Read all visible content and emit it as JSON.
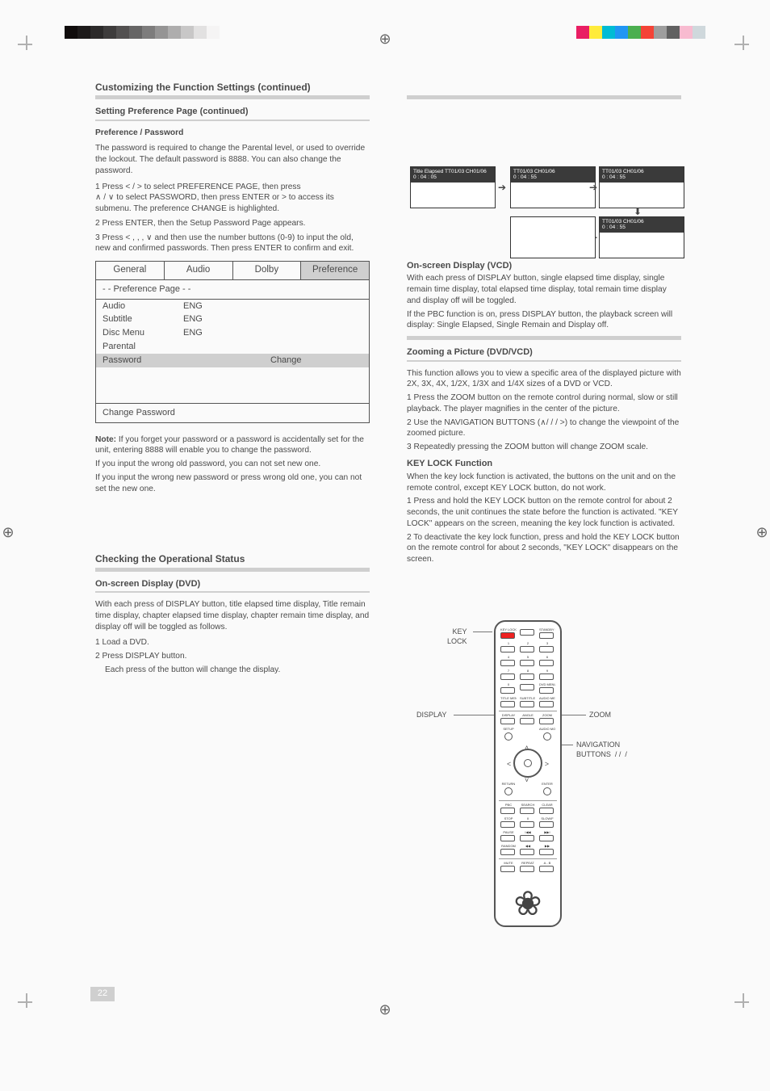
{
  "colorbar_left": [
    "#100c0c",
    "#1d1a1a",
    "#2c2a2a",
    "#3e3c3c",
    "#525050",
    "#666565",
    "#7d7c7c",
    "#959494",
    "#aeadad",
    "#c8c7c7",
    "#e2e1e1",
    "#f5f4f4"
  ],
  "colorbar_right": [
    "#e91e63",
    "#ffeb3b",
    "#00bcd4",
    "#2196f3",
    "#4caf50",
    "#f44336",
    "#9e9e9e",
    "#616161",
    "#f8bbd0",
    "#cfd8dc"
  ],
  "left": {
    "h_customizing": "Customizing the Function Settings (continued)",
    "h_setting": "Setting Preference Page (continued)",
    "h_pref_pass": "Preference / Password",
    "p_pass": "The password is required to change the Parental level, or used to override the lockout. The default password is 8888. You can also change the password.",
    "li1_pre": "1    Press ",
    "li1_a": " / ",
    "li1_post": " to select PREFERENCE PAGE, then press",
    "li1b_pre": "",
    "li1b_a": " / ",
    "li1b_post": " to select PASSWORD, then press ENTER or > to access its submenu. The preference CHANGE is highlighted.",
    "li2": "2    Press ENTER, then the Setup Password Page appears.",
    "li3_pre": "3    Press ",
    "li3_mid": " ,  ,  , ",
    "li3_post": " and then use the number buttons (0-9) to input the old, new and confirmed passwords. Then press ENTER to confirm and exit.",
    "menu": {
      "tabs": [
        "General",
        "Audio",
        "Dolby",
        "Preference"
      ],
      "page_title": "- -  Preference  Page  - -",
      "rows": [
        {
          "k": "Audio",
          "v": "ENG"
        },
        {
          "k": "Subtitle",
          "v": "ENG"
        },
        {
          "k": "Disc Menu",
          "v": "ENG"
        },
        {
          "k": "Parental",
          "v": ""
        }
      ],
      "highlight_k": "Password",
      "highlight_a": "Change",
      "footer": "Change Password"
    },
    "note_label": "Note:",
    "note_text": "If you forget your password or a password is accidentally set for the unit, entering 8888 will enable you to change the password.",
    "br1": "       If you input the wrong old password, you can not set new one.",
    "br2": "       If you input the wrong new password or press wrong old one, you can not set the new one.",
    "h_status": "Checking the Operational Status",
    "h_display": "On-screen Display (DVD)",
    "p_disp": "With each press of DISPLAY button, title elapsed time display, Title remain time display, chapter elapsed time display, chapter remain time display, and display off will be toggled as follows.",
    "li_d1": "1    Load a DVD.",
    "li_d2": "2    Press DISPLAY button.",
    "p_foot": "Each press of the button will change the display."
  },
  "osd": {
    "l1a": "Title Elapsed TT01/03 CH01/06",
    "l1b": "0 : 04 : 05",
    "l2a": "TT01/03 CH01/06",
    "l2b": "0 : 04 : 55",
    "l3a": "TT01/03 CH01/06",
    "l3b": "0 : 04 : 55",
    "l4a": "TT01/03 CH01/06",
    "l4b": "0 : 04 : 55"
  },
  "right": {
    "h_vcd": "On-screen Display (VCD)",
    "p_vcd1": "With each press of DISPLAY button, single elapsed time display, single remain time display, total elapsed time display, total remain time display and display off will be toggled.",
    "p_vcd2": "If the PBC function is on, press DISPLAY button, the playback screen will display: Single Elapsed, Single Remain and Display off.",
    "h_zoom": "Zooming a Picture (DVD/VCD)",
    "p_zoom1": "This function allows you to view a specific area of the displayed picture with 2X, 3X, 4X, 1/2X, 1/3X and 1/4X sizes of a DVD or VCD.",
    "li_z1": "1    Press the ZOOM button on the remote control during normal, slow or still playback. The player magnifies in the center of the picture.",
    "li_z2_pre": "2    Use the NAVIGATION BUTTONS (",
    "li_z2_mid": "/  /  / ",
    "li_z2_post": ") to change the viewpoint of the zoomed picture.",
    "li_z3": "3    Repeatedly pressing the ZOOM button will change ZOOM scale.",
    "h_keylock": "KEY LOCK Function",
    "p_kl": "When the key lock function is activated, the buttons on the unit and on the remote control, except KEY LOCK button, do not work.",
    "li_k1": "1    Press and hold the KEY LOCK button on the remote control for about 2 seconds, the unit continues the state before the function is activated. \"KEY LOCK\" appears on the screen, meaning the key lock function is activated.",
    "li_k2": "2    To deactivate the key lock function, press and hold the KEY LOCK button on the remote control for about 2 seconds, \"KEY LOCK\" disappears on the screen."
  },
  "callouts": {
    "key_lock": "KEY\nLOCK",
    "display": "DISPLAY",
    "zoom": "ZOOM",
    "nav": "NAVIGATION\nBUTTONS  / /  /"
  },
  "remote_labels": {
    "r1": [
      "KEY LOCK",
      "",
      "STANDBY ON/OFF"
    ],
    "r2": [
      "1",
      "2",
      "3"
    ],
    "r3": [
      "4",
      "5",
      "6"
    ],
    "r4": [
      "7",
      "8",
      "9"
    ],
    "r5": [
      "0",
      "",
      "DVD MENU"
    ],
    "r6": [
      "TITLE MENU",
      "SUBTITLE MENU",
      "AUDIO MENU"
    ],
    "r7": [
      "DISPLAY",
      "ANGLE",
      "ZOOM"
    ],
    "c1": [
      "SETUP",
      "",
      "AUDIO MODE"
    ],
    "c2": [
      "RETURN",
      "",
      "ENTER"
    ],
    "r8": [
      "PBC",
      "SEARCH",
      "CLEAR"
    ],
    "r9": [
      "STOP",
      "II",
      "SLOW/F"
    ],
    "r10": [
      "PAUSE",
      "I◀◀",
      "▶▶I"
    ],
    "r11": [
      "RANDOM",
      "◀◀",
      "▶▶"
    ],
    "r12": [
      "MUTE",
      "REPEAT",
      "A - B"
    ]
  },
  "page_number": "22"
}
